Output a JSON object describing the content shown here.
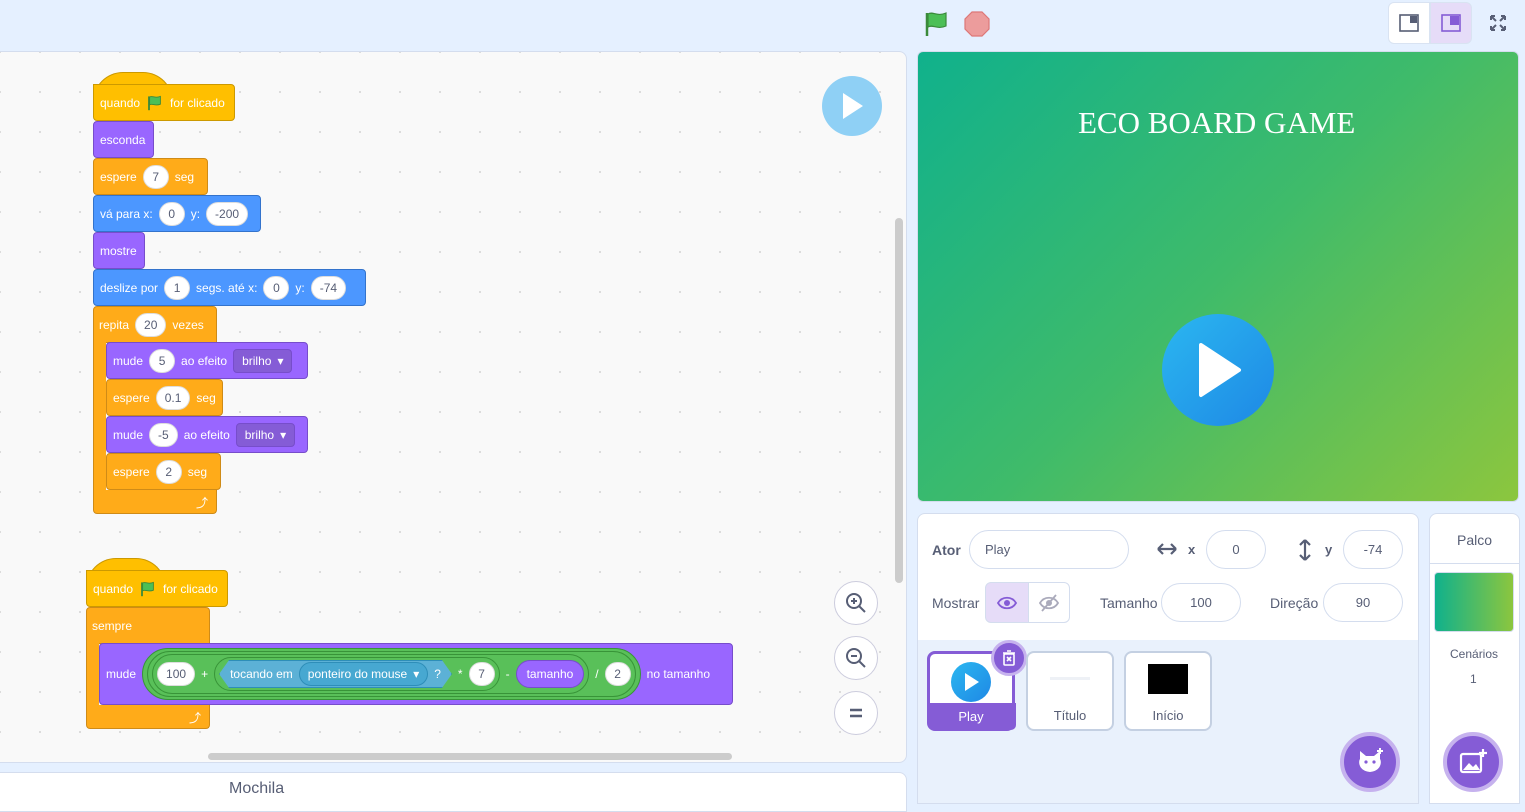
{
  "code": {
    "script1": {
      "hat_when": "quando",
      "hat_clicked": "for clicado",
      "hide": "esconda",
      "wait1": {
        "label": "espere",
        "value": "7",
        "unit": "seg"
      },
      "goto": {
        "label": "vá para x:",
        "x": "0",
        "ylabel": "y:",
        "y": "-200"
      },
      "show": "mostre",
      "glide": {
        "label": "deslize por",
        "secs": "1",
        "to": "segs. até x:",
        "x": "0",
        "ylabel": "y:",
        "y": "-74"
      },
      "repeat": {
        "label": "repita",
        "value": "20",
        "unit": "vezes"
      },
      "change1": {
        "label": "mude",
        "value": "5",
        "effect_label": "ao efeito",
        "effect": "brilho"
      },
      "wait2": {
        "label": "espere",
        "value": "0.1",
        "unit": "seg"
      },
      "change2": {
        "label": "mude",
        "value": "-5",
        "effect_label": "ao efeito",
        "effect": "brilho"
      },
      "wait3": {
        "label": "espere",
        "value": "2",
        "unit": "seg"
      }
    },
    "script2": {
      "hat_when": "quando",
      "hat_clicked": "for clicado",
      "forever": "sempre",
      "change_size": {
        "label": "mude",
        "a": "100",
        "plus": "+",
        "touching": "tocando em",
        "target": "ponteiro do mouse",
        "q": "?",
        "times": "*",
        "b": "7",
        "minus": "-",
        "size": "tamanho",
        "div": "/",
        "c": "2",
        "suffix": "no tamanho"
      }
    }
  },
  "backpack_label": "Mochila",
  "stage": {
    "title": "ECO BOARD GAME"
  },
  "sprite_info": {
    "sprite_label": "Ator",
    "sprite_name": "Play",
    "x_label": "x",
    "x_value": "0",
    "y_label": "y",
    "y_value": "-74",
    "show_label": "Mostrar",
    "size_label": "Tamanho",
    "size_value": "100",
    "direction_label": "Direção",
    "direction_value": "90"
  },
  "sprites": [
    {
      "name": "Play",
      "selected": true
    },
    {
      "name": "Título",
      "selected": false
    },
    {
      "name": "Início",
      "selected": false
    }
  ],
  "stage_panel": {
    "title": "Palco",
    "backdrops_label": "Cenários",
    "backdrops_count": "1"
  },
  "colors": {
    "events": "#ffbf00",
    "looks": "#9966ff",
    "control": "#ffab19",
    "motion": "#4c97ff",
    "operators": "#59c059",
    "sensing": "#5cb1d6",
    "accent": "#855cd6"
  }
}
